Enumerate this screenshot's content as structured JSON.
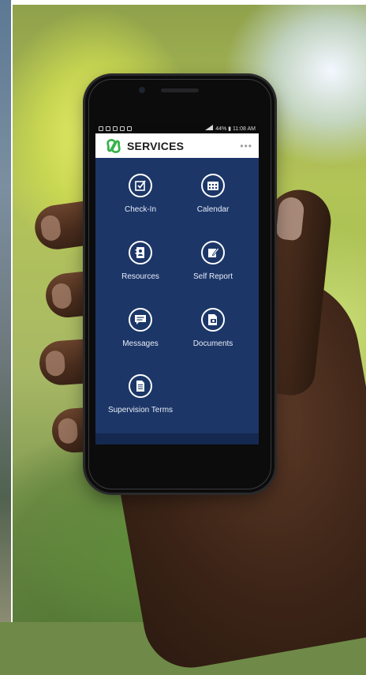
{
  "app": {
    "title": "SERVICES",
    "more_label": "•••"
  },
  "statusbar": {
    "right_text": "44% ▮ 11:08 AM"
  },
  "services": [
    {
      "label": "Check-In",
      "icon": "checkbox-icon"
    },
    {
      "label": "Calendar",
      "icon": "calendar-icon"
    },
    {
      "label": "Resources",
      "icon": "contacts-book-icon"
    },
    {
      "label": "Self Report",
      "icon": "edit-note-icon"
    },
    {
      "label": "Messages",
      "icon": "message-bubble-icon"
    },
    {
      "label": "Documents",
      "icon": "document-camera-icon"
    },
    {
      "label": "Supervision Terms",
      "icon": "terms-document-icon"
    }
  ],
  "colors": {
    "screen_background": "#1c3668",
    "appbar_background": "#ffffff",
    "logo_green": "#36b24a"
  }
}
